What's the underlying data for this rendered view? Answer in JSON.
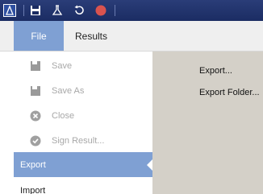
{
  "titlebar": {
    "icons": [
      "app-logo-icon",
      "save-icon",
      "flask-icon",
      "undo-icon",
      "record-icon"
    ],
    "colors": {
      "background": "#1b2c63",
      "record": "#d9534f"
    }
  },
  "menubar": {
    "tabs": [
      {
        "label": "File",
        "active": true
      },
      {
        "label": "Results",
        "active": false
      }
    ],
    "accent": "#7fa0d3"
  },
  "file_menu": {
    "items": [
      {
        "label": "Save",
        "icon": "save-icon",
        "enabled": false
      },
      {
        "label": "Save As",
        "icon": "save-as-icon",
        "enabled": false
      },
      {
        "label": "Close",
        "icon": "close-circle-icon",
        "enabled": false
      },
      {
        "label": "Sign Result...",
        "icon": "check-circle-icon",
        "enabled": false
      },
      {
        "label": "Export",
        "selected": true
      },
      {
        "label": "Import"
      }
    ]
  },
  "export_submenu": {
    "items": [
      "Export...",
      "Export Folder..."
    ]
  }
}
